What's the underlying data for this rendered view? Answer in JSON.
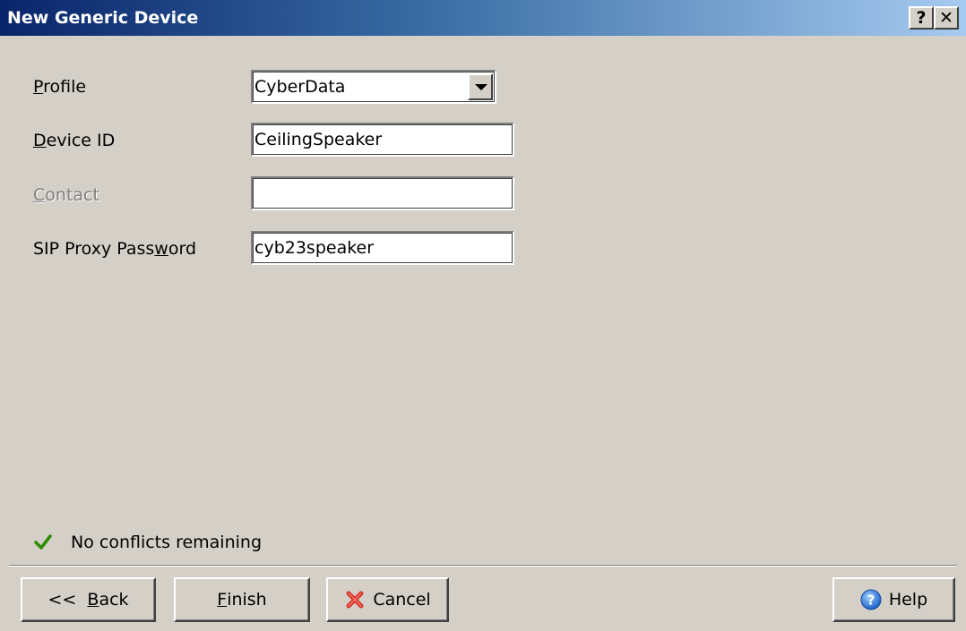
{
  "window": {
    "title": "New Generic Device",
    "help_glyph": "?",
    "close_glyph": "✕"
  },
  "form": {
    "profile": {
      "label_mnemonic": "P",
      "label_rest": "rofile",
      "value": "CyberData"
    },
    "device_id": {
      "label_mnemonic": "D",
      "label_rest": "evice ID",
      "value": "CeilingSpeaker"
    },
    "contact": {
      "label_mnemonic": "C",
      "label_rest": "ontact",
      "value": "",
      "disabled": true
    },
    "sip_password": {
      "label_pre": "SIP Proxy Pass",
      "label_mnemonic": "w",
      "label_rest": "ord",
      "value": "cyb23speaker"
    }
  },
  "status": {
    "icon": "checkmark-icon",
    "text": "No conflicts remaining",
    "color": "#2e8b00"
  },
  "buttons": {
    "back": {
      "pre": "<<  ",
      "mnemonic": "B",
      "rest": "ack"
    },
    "finish": {
      "mnemonic": "F",
      "rest": "inish"
    },
    "cancel": {
      "label": "Cancel",
      "icon": "red-x-icon"
    },
    "help": {
      "label": "Help",
      "icon": "help-circle-icon"
    }
  },
  "colors": {
    "title_gradient_start": "#0a246a",
    "title_gradient_end": "#a6caf0",
    "face": "#d4d0c8"
  }
}
